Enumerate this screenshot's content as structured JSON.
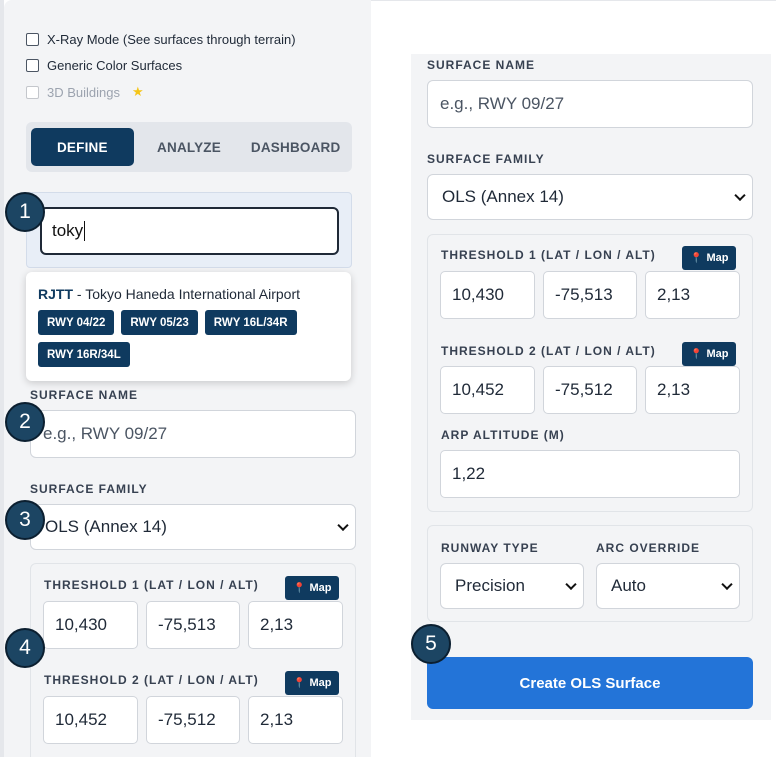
{
  "options": {
    "xray_label": "X-Ray Mode (See surfaces through terrain)",
    "generic_color_label": "Generic Color Surfaces",
    "buildings_label": "3D Buildings",
    "buildings_star": "★"
  },
  "tabs": [
    {
      "label": "DEFINE",
      "active": true
    },
    {
      "label": "ANALYZE",
      "active": false
    },
    {
      "label": "DASHBOARD",
      "active": false
    }
  ],
  "search": {
    "value": "toky"
  },
  "search_result": {
    "code": "RJTT",
    "separator": " - ",
    "name": "Tokyo Haneda International Airport",
    "runways": [
      "RWY 04/22",
      "RWY 05/23",
      "RWY 16L/34R",
      "RWY 16R/34L"
    ]
  },
  "form": {
    "surface_name_label": "SURFACE NAME",
    "surface_name_placeholder": "e.g., RWY 09/27",
    "surface_family_label": "SURFACE FAMILY",
    "surface_family_value": "OLS (Annex 14)",
    "threshold1_label": "THRESHOLD 1 (LAT / LON / ALT)",
    "threshold2_label": "THRESHOLD 2 (LAT / LON / ALT)",
    "map_label": "Map",
    "threshold1": {
      "lat": "10,430",
      "lon": "-75,513",
      "alt": "2,13"
    },
    "threshold2": {
      "lat": "10,452",
      "lon": "-75,512",
      "alt": "2,13"
    },
    "arp_altitude_label": "ARP ALTITUDE (M)",
    "arp_altitude_value": "1,22",
    "runway_type_label": "RUNWAY TYPE",
    "runway_type_value": "Precision",
    "arc_override_label": "ARC OVERRIDE",
    "arc_override_value": "Auto",
    "create_label": "Create OLS Surface"
  },
  "badges": [
    "1",
    "2",
    "3",
    "4",
    "5"
  ],
  "colors": {
    "primary": "#0f3a5f",
    "accent": "#2374d8",
    "badge": "#1c4563"
  }
}
